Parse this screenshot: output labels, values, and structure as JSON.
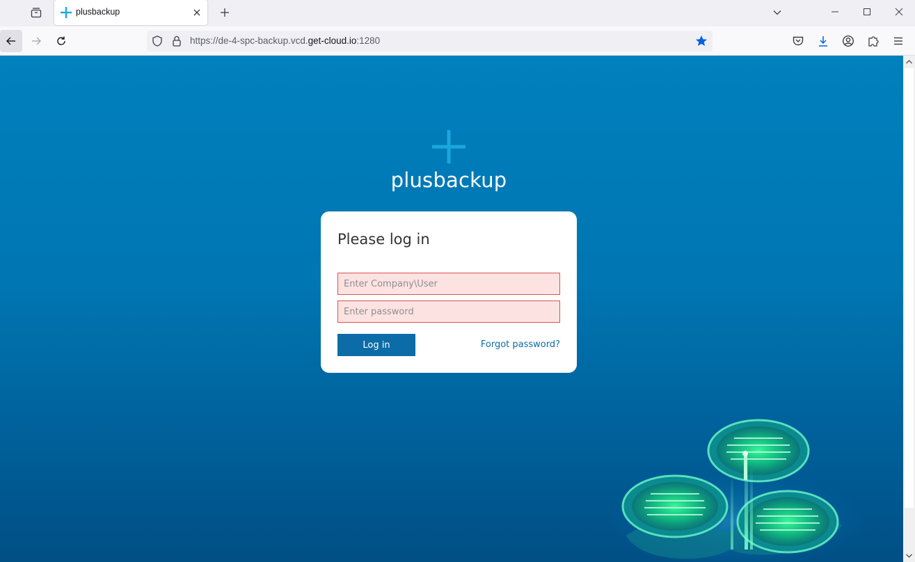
{
  "browser": {
    "tab": {
      "title": "plusbackup"
    },
    "url": {
      "prefix": "https://de-4-spc-backup.vcd.",
      "host": "get-cloud.io",
      "suffix": ":1280"
    }
  },
  "page": {
    "brand": "plusbackup",
    "login": {
      "title": "Please log in",
      "username_placeholder": "Enter Company\\User",
      "password_placeholder": "Enter password",
      "submit_label": "Log in",
      "forgot_label": "Forgot password?"
    }
  },
  "colors": {
    "accent": "#0b6ca8",
    "background_top": "#0080bd",
    "background_bottom": "#004f85",
    "field_error_bg": "#fde2e2",
    "field_error_border": "#d9534f",
    "logo": "#1aa7e0"
  },
  "icons": {
    "list_all_tabs": "list-all-tabs-icon",
    "favicon": "plus-icon",
    "tab_close": "close-icon",
    "new_tab": "plus-icon",
    "back": "arrow-left-icon",
    "forward": "arrow-right-icon",
    "reload": "reload-icon",
    "tracking_protection": "shield-icon",
    "secure": "lock-icon",
    "bookmark": "star-icon",
    "pocket": "pocket-icon",
    "downloads": "download-icon",
    "account": "account-icon",
    "extensions": "puzzle-icon",
    "menu": "hamburger-menu-icon"
  }
}
